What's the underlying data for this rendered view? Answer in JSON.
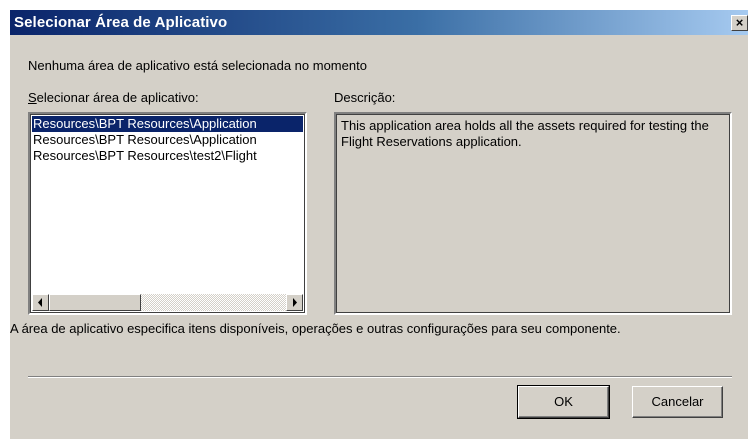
{
  "window": {
    "title": "Selecionar Área de Aplicativo",
    "close_glyph": "×"
  },
  "status_message": "Nenhuma área de aplicativo está selecionada no momento",
  "list": {
    "label_mnemonic": "S",
    "label_rest": "elecionar área de aplicativo:",
    "items": [
      {
        "text": "Resources\\BPT Resources\\Application",
        "selected": true
      },
      {
        "text": "Resources\\BPT Resources\\Application",
        "selected": false
      },
      {
        "text": "Resources\\BPT Resources\\test2\\Flight",
        "selected": false
      }
    ]
  },
  "description": {
    "label": "Descrição:",
    "text": "This application area holds all the assets required for testing the Flight Reservations application."
  },
  "info_text": "A área de aplicativo especifica itens disponíveis, operações e outras configurações para seu componente.",
  "buttons": {
    "ok": "OK",
    "cancel": "Cancelar"
  },
  "icons": {
    "close": "close-icon",
    "scroll_left": "arrow-left-icon",
    "scroll_right": "arrow-right-icon"
  },
  "colors": {
    "title_start": "#0a246a",
    "title_end": "#a6caf0",
    "selection": "#0a246a",
    "face": "#d4d0c8"
  }
}
